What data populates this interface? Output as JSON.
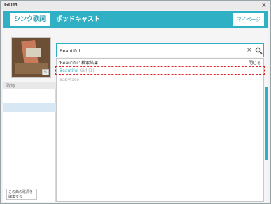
{
  "window": {
    "title": "GOM",
    "close_symbol": "×"
  },
  "header": {
    "tab_active": "シンク歌詞",
    "separator": "・",
    "tab_podcast": "ポッドキャスト",
    "mypage_label": "マイページ"
  },
  "left_panel": {
    "header_label": "歌詞",
    "edit_button_label": "この曲の歌詞を編集する"
  },
  "search": {
    "value": "Beautiful",
    "clear_symbol": "×"
  },
  "results": {
    "header_title": "'Beautiful' 検索結果",
    "close_label": "閉じる",
    "items": [
      {
        "highlight": "Beautiful",
        "rest": " Girl (1)"
      },
      {
        "highlight": "",
        "rest": "Babyface"
      }
    ]
  },
  "colors": {
    "accent": "#2fb0c4",
    "selection_outline": "#e0242a"
  }
}
